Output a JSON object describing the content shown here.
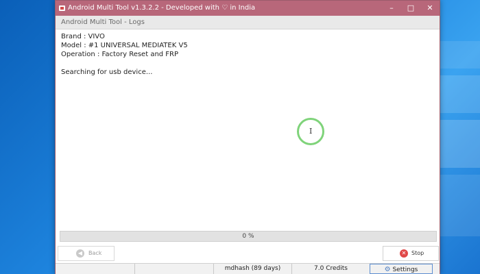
{
  "window": {
    "title_prefix": "Android Multi Tool v1.3.2.2 - Developed with",
    "title_suffix": "in India",
    "heart": "♡",
    "minimize": "–",
    "maximize": "□",
    "close": "✕"
  },
  "header": {
    "title": "Android Multi Tool - Logs"
  },
  "logs": {
    "brand": "Brand : VIVO",
    "model": "Model : #1 UNIVERSAL MEDIATEK V5",
    "operation": "Operation : Factory Reset and FRP",
    "status": "Searching for usb device..."
  },
  "progress": {
    "label": "0 %",
    "value": 0
  },
  "buttons": {
    "back_label": "Back",
    "back_icon": "◀",
    "stop_label": "Stop",
    "stop_icon": "✕"
  },
  "statusbar": {
    "user": "mdhash (89 days)",
    "credits": "7.0 Credits",
    "settings": "Settings",
    "settings_icon": "⚙"
  },
  "colors": {
    "titlebar": "#b8677a",
    "stop_red": "#e04848",
    "cursor_ring": "#7fd37a"
  }
}
